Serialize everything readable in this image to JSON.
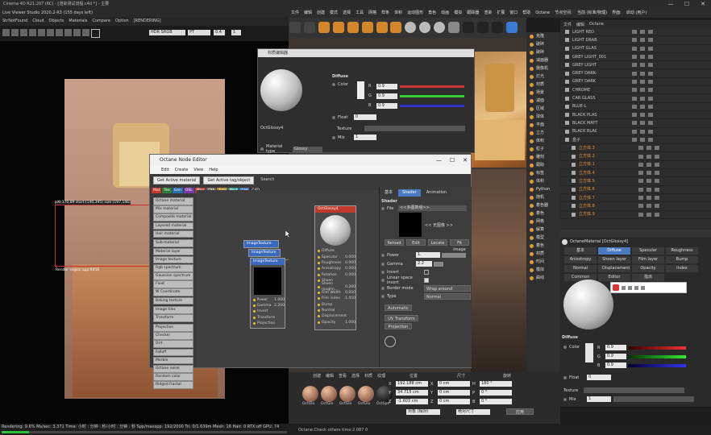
{
  "title_bar": {
    "title": "Cinema 4D R21.207 (RC) - [渲染测试流程.c4d *] - 主要",
    "min": "—",
    "max": "☐",
    "close": "✕"
  },
  "live_viewer": {
    "title": "Live Viewer Studio 2020.2-R3 (155 days left)",
    "menu": [
      "StrNotFound",
      "Cloud",
      "Objects",
      "Materials",
      "Compare",
      "Option",
      "[RENDERING]"
    ],
    "toolbar": {
      "colorspace": "HDR SRGB",
      "tonemap": "PT",
      "value1": "0.4",
      "value2": "1"
    },
    "info_text": "pXl:170,89 start:(140,395) size:(197,146)",
    "region_text": "Render region spp:9456",
    "status": "Rendering: 9.6%   Ms/sec: 3.371   Time: 小时 : 分钟 : 秒/小时 : 分钟 : 秒   Spp/maxspp: 192/2000   Tri: 0/1.639m   Mesh: 16   Hair: 0   RTX:off   GPU: 74"
  },
  "c4d_menu": [
    "文件",
    "编辑",
    "创建",
    "模式",
    "选择",
    "工具",
    "网格",
    "样条",
    "体积",
    "运动图形",
    "角色",
    "动画",
    "模拟",
    "跟踪器",
    "渲染",
    "扩展",
    "窗口",
    "帮助",
    "Octane",
    "节点空间:",
    "当前 (标准/物理)",
    "界面:",
    "启动 (用户)"
  ],
  "material_editor": {
    "title": "材质编辑器",
    "section": "Diffuse",
    "color_label": "Color",
    "r": "0.9",
    "g": "0.9",
    "b": "0.9",
    "float_label": "Float",
    "float_value": "0",
    "texture_label": "Texture",
    "mix_label": "Mix",
    "mix_value": "1",
    "mat_name": "OctGlossy4",
    "mat_type_label": "Material type",
    "mat_type": "Glossy"
  },
  "node_editor": {
    "title": "Octane Node Editor",
    "menu": [
      "Edit",
      "Create",
      "View",
      "Help"
    ],
    "buttons": [
      "Get Active material",
      "Get Active tag/object",
      "Search"
    ],
    "tags": [
      {
        "label": "Mat",
        "color": "#c0392b"
      },
      {
        "label": "Tex",
        "color": "#2f7d3a"
      },
      {
        "label": "Gen",
        "color": "#2c6eb0"
      },
      {
        "label": "OSL",
        "color": "#7a3aa3"
      },
      {
        "label": "Map",
        "color": "#b54040"
      },
      {
        "label": "Oth",
        "color": "#6a6a6a"
      },
      {
        "label": "Emi",
        "color": "#b88b2a"
      },
      {
        "label": "Med",
        "color": "#2a9b8b"
      },
      {
        "label": "Lay",
        "color": "#4a7ac0"
      },
      {
        "label": "C4D",
        "color": "#333333"
      }
    ],
    "node_list": [
      "Octane material",
      "Mix material",
      "Composite material",
      "Layered material",
      "Hair material",
      "Sub-material",
      "Material layer",
      "Image texture",
      "Rgb spectrum",
      "Gaussian spectrum",
      "Float",
      "W Coordinate",
      "Baking texture",
      "Image tiles",
      "Transform",
      "Projection",
      "Checker",
      "Dirt",
      "Falloff",
      "Marble",
      "Octane noise",
      "Random color",
      "Ridged fractal"
    ],
    "image_nodes": [
      "ImageTexture",
      "ImageTexture",
      "ImageTexture"
    ],
    "image_ports": [
      "Power",
      "Gamma",
      "Invert",
      "Transform",
      "Projection"
    ],
    "image_port_values": [
      "1.000",
      "2.200",
      "",
      "",
      ""
    ],
    "glossy_node": {
      "title": "OctGlossy4",
      "ports": [
        "Diffuse",
        "Specular",
        "Roughness",
        "Anisotropy",
        "Rotation",
        "Sheen",
        "Sheen roughn...",
        "Film Width",
        "Film index",
        "Bump",
        "Normal",
        "Displacement",
        "Opacity"
      ],
      "values": [
        "",
        "0.000",
        "0.000",
        "0.000",
        "0.000",
        "",
        "0.200",
        "0.000",
        "1.450",
        "",
        "",
        "",
        "1.000"
      ]
    },
    "shader_panel": {
      "tabs": [
        "基本",
        "Shader",
        "Animation"
      ],
      "heading": "Shader",
      "file_label": "File",
      "file_value": "<<多图数组>>",
      "no_image": "<< 无图像 >>",
      "buttons": [
        "Reload",
        "Edit",
        "Locate",
        "Fit image"
      ],
      "power_label": "Power",
      "power_value": "1.",
      "gamma_label": "Gamma",
      "gamma_value": "2.2",
      "invert_label": "Invert",
      "linear_label": "Linear space invert",
      "border_label": "Border mode",
      "border_value": "Wrap around",
      "type_label": "Type",
      "type_value": "Normal",
      "automatic": "Automatic",
      "uv_transform": "UV Transform",
      "projection": "Projection"
    }
  },
  "object_list": [
    "LIGHT RED",
    "LIGHT DRAB",
    "LIGHT GLAS",
    "GREY LIGHT_001",
    "GREY LIGHT",
    "GREY DARK-",
    "GREY DARK",
    "CHROME",
    "CAR GLASS",
    "BLUE-L",
    "BLACK PLAS",
    "BLACK MATT",
    "BLACK BLAC",
    "盒子",
    "立方体.3",
    "立方体.2",
    "立方体.1",
    "立方体.4",
    "立方体.5",
    "立方体.6",
    "立方体.7",
    "立方体.8",
    "立方体.9"
  ],
  "sidebar_items": [
    "克隆",
    "破碎",
    "破碎",
    "减面器",
    "摄像机",
    "灯光",
    "材质",
    "场景",
    "减面",
    "区域",
    "球体",
    "平面",
    "立方",
    "体积",
    "粒子",
    "雕刻",
    "跟踪",
    "标签",
    "体积",
    "Python",
    "随机",
    "着色器",
    "着色",
    "网格",
    "解算",
    "模型",
    "着色",
    "材质",
    "时间",
    "模拟",
    "曲线"
  ],
  "attributes": {
    "title": "OctaneMaterial [OctGlossy4]",
    "tabs1": [
      "基本",
      "Diffuse",
      "Specular",
      "Roughness"
    ],
    "tabs2": [
      "Anisotropy",
      "Sheen layer",
      "Film layer",
      "Bump"
    ],
    "tabs3": [
      "Normal",
      "Displacement",
      "Opacity",
      "Index"
    ],
    "tabs4": [
      "Common",
      "Editor",
      "指派"
    ],
    "section": "Diffuse",
    "color_label": "Color",
    "r": "0.9",
    "g": "0.9",
    "b": "0.9",
    "float_label": "Float",
    "float_value": "0",
    "texture_label": "Texture",
    "mix_label": "Mix",
    "mix_value": "1"
  },
  "bottom": {
    "menu": [
      "创建",
      "编辑",
      "查看",
      "选择",
      "材质",
      "纹理"
    ],
    "materials": [
      "OctGlo",
      "OctGlo",
      "OctGlo",
      "OctGlo",
      "OctSpe"
    ],
    "coord_headers": [
      "位置",
      "尺寸",
      "旋转"
    ],
    "pos": [
      "192.188 cm",
      "34.715 cm",
      "-1.603 cm"
    ],
    "size": [
      "0 cm",
      "0 cm",
      "0 cm"
    ],
    "rot": [
      "180 °",
      "0 °",
      "0 °"
    ],
    "axes": [
      "X",
      "Y",
      "Z"
    ],
    "rot_axes": [
      "H",
      "P",
      "B"
    ],
    "mode1": "对象 (相对)",
    "mode2": "绝对尺寸",
    "apply": "应用"
  },
  "c4d_status": "Octane:Check others time:2.087  0"
}
